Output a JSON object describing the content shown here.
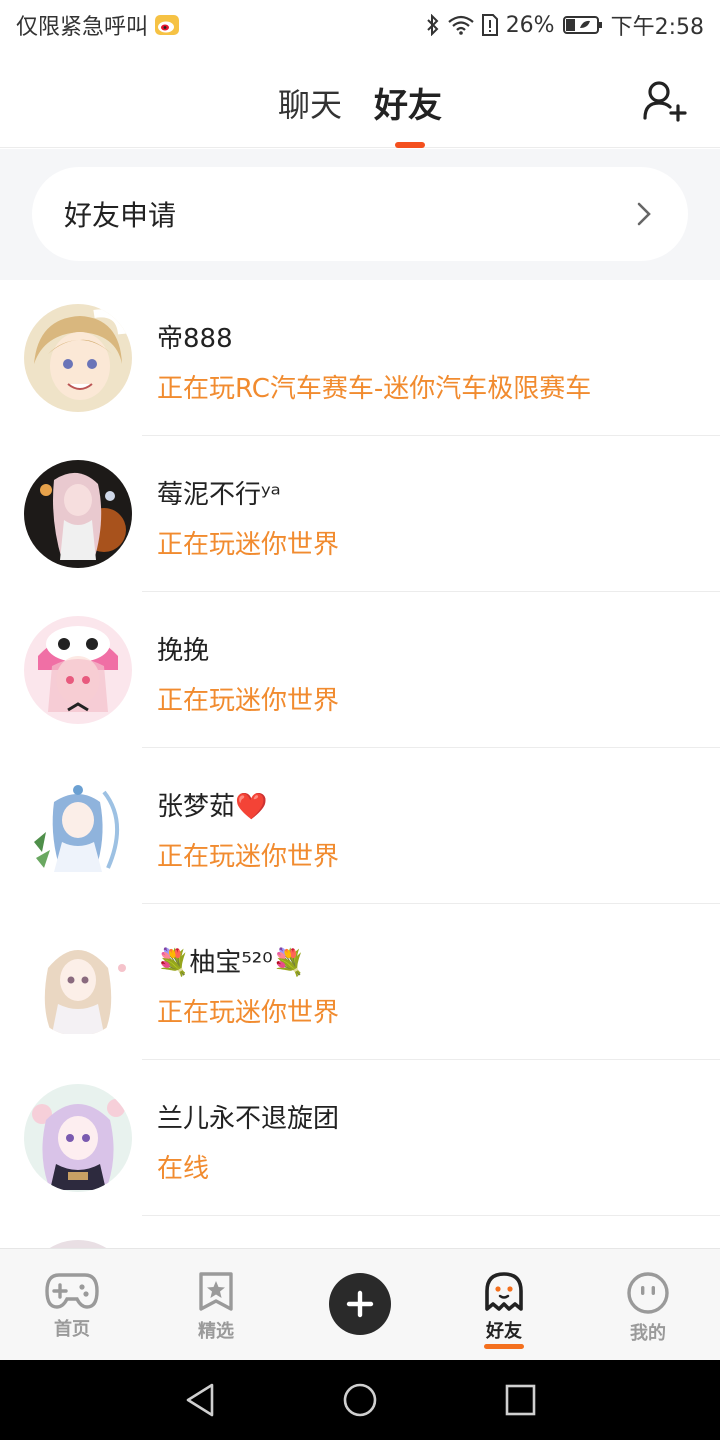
{
  "status_bar": {
    "left_text": "仅限紧急呼叫",
    "battery": "26%",
    "time": "下午2:58"
  },
  "header": {
    "tabs": [
      {
        "label": "聊天",
        "active": false
      },
      {
        "label": "好友",
        "active": true
      }
    ],
    "accent_color": "#f4501e"
  },
  "friend_request": {
    "label": "好友申请"
  },
  "friends": [
    {
      "name": "帝888",
      "status": "正在玩RC汽车赛车-迷你汽车极限赛车"
    },
    {
      "name": "莓泥不行ʸᵃ",
      "status": "正在玩迷你世界"
    },
    {
      "name": "挽挽",
      "status": "正在玩迷你世界"
    },
    {
      "name": "张梦茹⁣❤️",
      "status": "正在玩迷你世界"
    },
    {
      "name": "💐柚宝⁵²⁰💐",
      "status": "正在玩迷你世界"
    },
    {
      "name": "兰儿永不退旋团",
      "status": "在线"
    }
  ],
  "status_color": "#f18b2f",
  "bottom_nav": [
    {
      "label": "首页",
      "icon": "gamepad-icon"
    },
    {
      "label": "精选",
      "icon": "bookmark-star-icon"
    },
    {
      "label": "",
      "icon": "plus-icon"
    },
    {
      "label": "好友",
      "icon": "ghost-icon",
      "active": true
    },
    {
      "label": "我的",
      "icon": "face-icon"
    }
  ],
  "system_nav": [
    "back-icon",
    "home-icon",
    "recents-icon"
  ]
}
